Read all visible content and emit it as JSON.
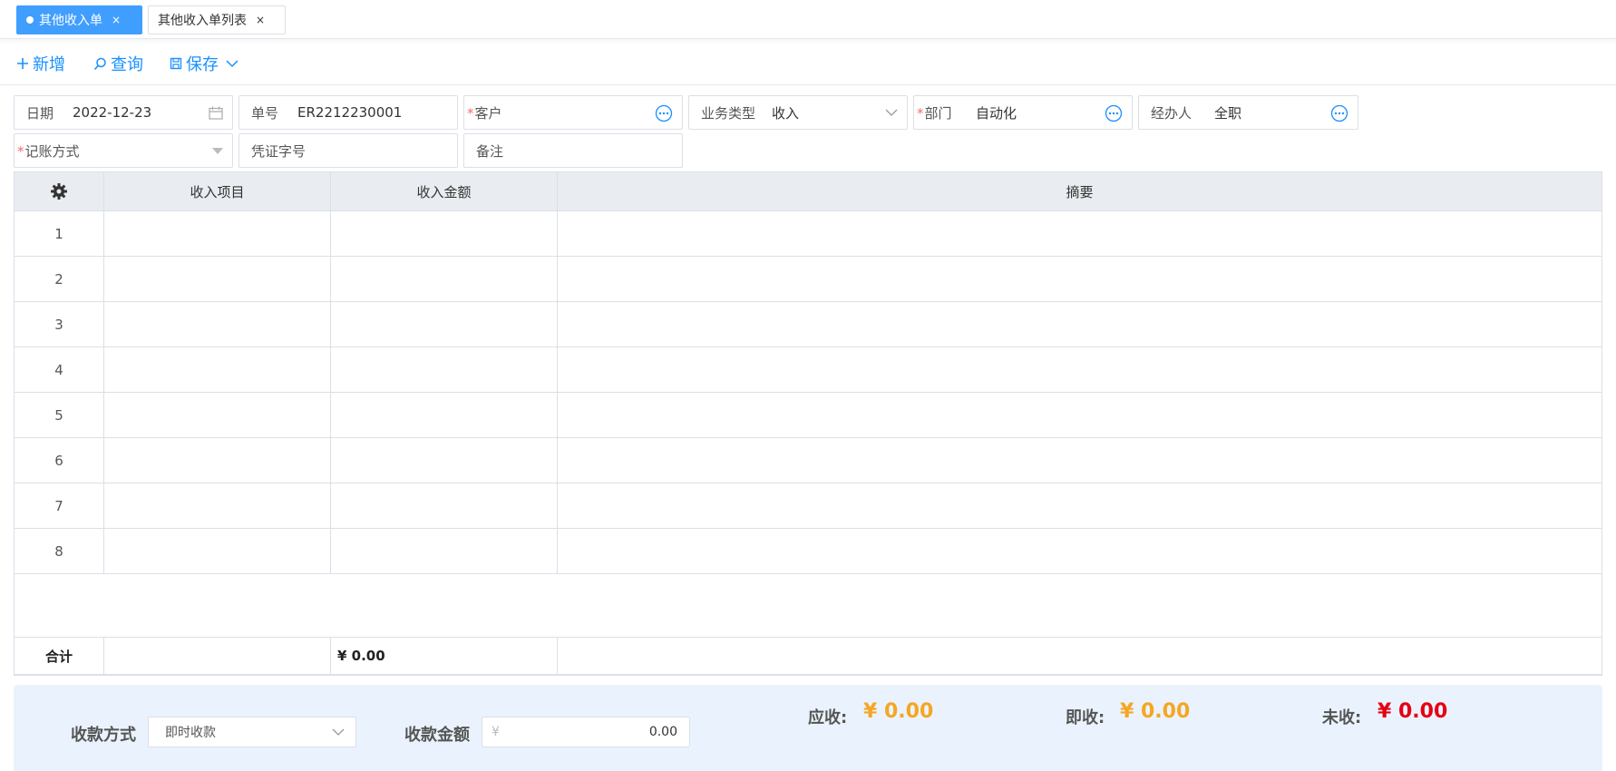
{
  "tabs": [
    {
      "label": "其他收入单",
      "close": "×"
    },
    {
      "label": "其他收入单列表",
      "close": "×"
    }
  ],
  "toolbar": {
    "add": "新增",
    "query": "查询",
    "save": "保存"
  },
  "form": {
    "date": {
      "label": "日期",
      "value": "2022-12-23"
    },
    "number": {
      "label": "单号",
      "value": "ER2212230001"
    },
    "customer": {
      "label": "客户",
      "value": "",
      "required_mark": "*"
    },
    "business_type": {
      "label": "业务类型",
      "value": "收入"
    },
    "department": {
      "label": "部门",
      "value": "自动化",
      "required_mark": "*"
    },
    "handler": {
      "label": "经办人",
      "value": "全职"
    },
    "accounting_method": {
      "label": "记账方式",
      "value": "",
      "required_mark": "*"
    },
    "voucher_no": {
      "label": "凭证字号",
      "value": ""
    },
    "remark": {
      "label": "备注",
      "value": ""
    }
  },
  "grid": {
    "columns": [
      "收入项目",
      "收入金额",
      "摘要"
    ],
    "rows": [
      "1",
      "2",
      "3",
      "4",
      "5",
      "6",
      "7",
      "8"
    ],
    "total_label": "合计",
    "total_amount": "¥ 0.00"
  },
  "payment": {
    "method_label": "收款方式",
    "method_value": "即时收款",
    "amount_label": "收款金额",
    "amount_prefix": "¥",
    "amount_value": "0.00"
  },
  "summary": {
    "receivable_label": "应收:",
    "receivable_value": "¥ 0.00",
    "received_label": "即收:",
    "received_value": "¥ 0.00",
    "unreceived_label": "未收:",
    "unreceived_value": "¥ 0.00"
  },
  "colors": {
    "accent": "#409eff",
    "orange": "#f5a623",
    "red": "#e60012"
  }
}
